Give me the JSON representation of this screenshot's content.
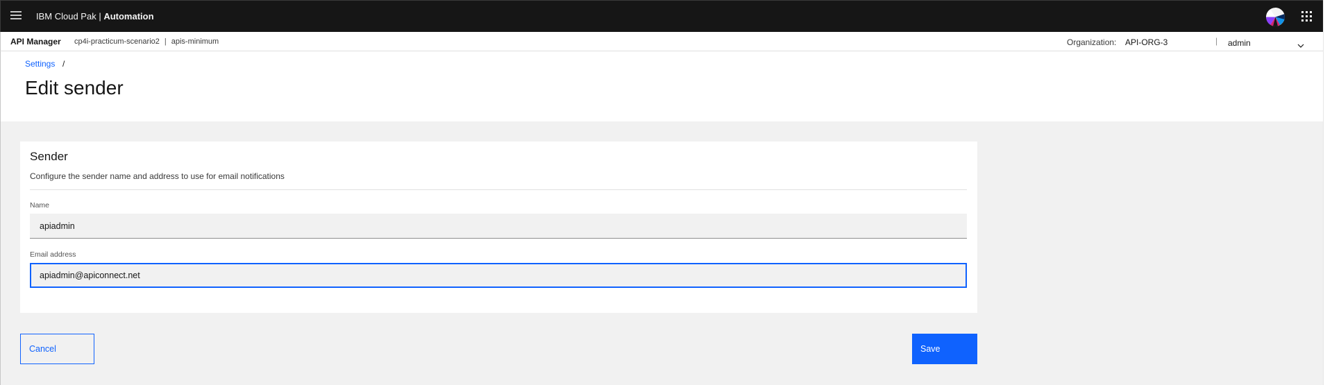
{
  "topbar": {
    "brand_prefix": "IBM Cloud Pak | ",
    "brand_strong": "Automation",
    "menu_icon": "hamburger-menu-icon",
    "avatar_icon": "user-avatar-icon",
    "apps_icon": "app-switcher-icon"
  },
  "subbar": {
    "product": "API Manager",
    "crumbs": [
      "cp4i-practicum-scenario2",
      "apis-minimum"
    ],
    "crumb_separator": "|",
    "org_label": "Organization:",
    "org_value": "API-ORG-3",
    "user_separator": "|",
    "user": "admin",
    "user_menu_icon": "chevron-down-icon"
  },
  "page": {
    "breadcrumb_link": "Settings",
    "breadcrumb_separator": "/",
    "title": "Edit sender"
  },
  "card": {
    "title": "Sender",
    "description": "Configure the sender name and address to use for email notifications",
    "fields": {
      "name": {
        "label": "Name",
        "value": "apiadmin"
      },
      "email": {
        "label": "Email address",
        "value": "apiadmin@apiconnect.net"
      }
    }
  },
  "actions": {
    "cancel": "Cancel",
    "save": "Save"
  },
  "colors": {
    "accent": "#0f62fe",
    "header_bg": "#161616",
    "field_bg": "#f1f1f1",
    "page_bg": "#f1f1f1"
  }
}
